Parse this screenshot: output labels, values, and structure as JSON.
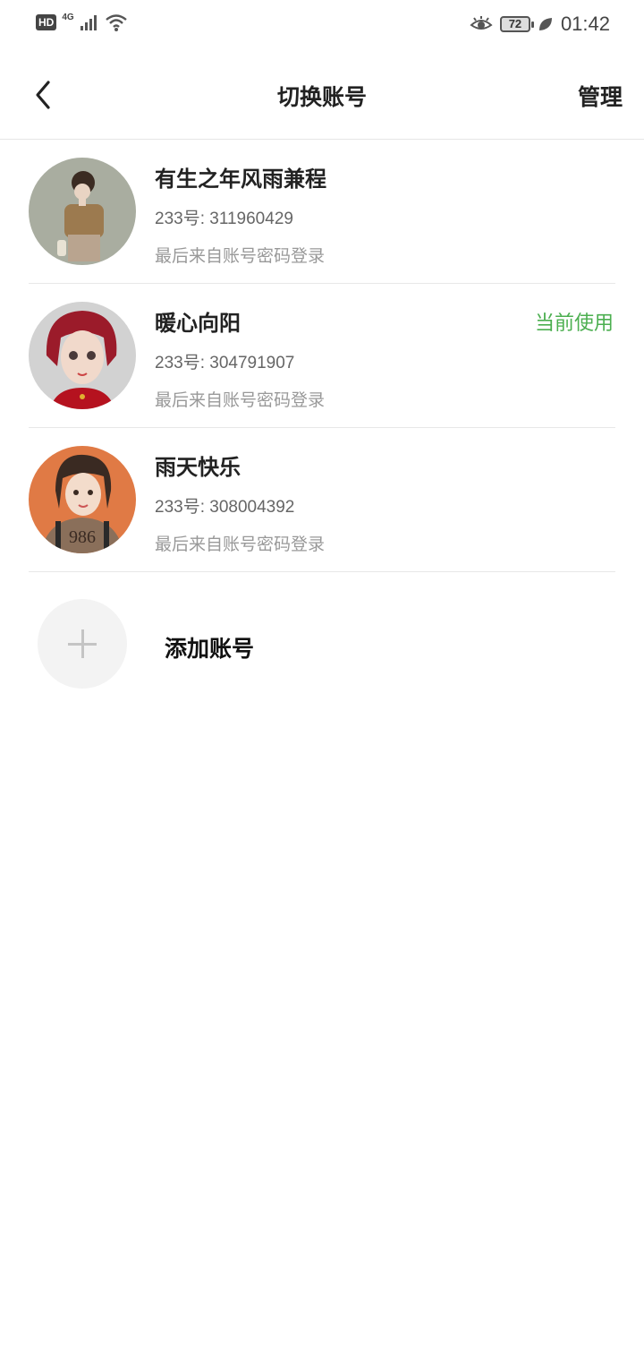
{
  "status_bar": {
    "hd": "HD",
    "network": "4G",
    "battery": "72",
    "time": "01:42",
    "icons": [
      "signal-icon",
      "wifi-icon",
      "eye-icon",
      "leaf-icon"
    ]
  },
  "header": {
    "title": "切换账号",
    "manage": "管理"
  },
  "accounts": [
    {
      "name": "有生之年风雨兼程",
      "id": "233号: 311960429",
      "login": "最后来自账号密码登录",
      "current": ""
    },
    {
      "name": "暖心向阳",
      "id": "233号: 304791907",
      "login": "最后来自账号密码登录",
      "current": "当前使用"
    },
    {
      "name": "雨天快乐",
      "id": "233号: 308004392",
      "login": "最后来自账号密码登录",
      "current": ""
    }
  ],
  "add_account": {
    "label": "添加账号"
  },
  "colors": {
    "accent_green": "#4caf50",
    "divider": "#e8e8e8",
    "add_circle_bg": "#f3f3f3"
  }
}
